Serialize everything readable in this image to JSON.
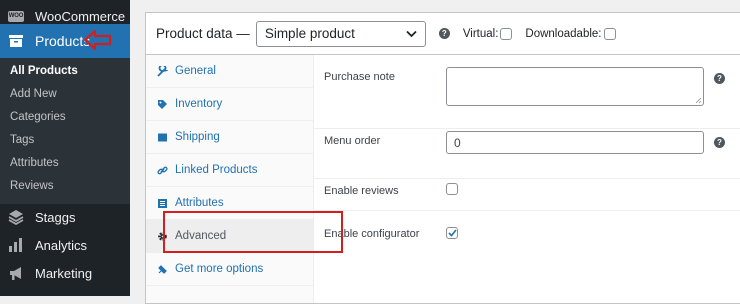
{
  "sidebar": {
    "woocommerce": {
      "label": "WooCommerce",
      "badge": "WOO"
    },
    "products": {
      "label": "Products"
    },
    "submenu": [
      {
        "label": "All Products",
        "active": true
      },
      {
        "label": "Add New"
      },
      {
        "label": "Categories"
      },
      {
        "label": "Tags"
      },
      {
        "label": "Attributes"
      },
      {
        "label": "Reviews"
      }
    ],
    "staggs": {
      "label": "Staggs"
    },
    "analytics": {
      "label": "Analytics"
    },
    "marketing": {
      "label": "Marketing"
    }
  },
  "product_data": {
    "label": "Product data —",
    "type_select": "Simple product",
    "virtual_label": "Virtual:",
    "downloadable_label": "Downloadable:",
    "virtual_checked": false,
    "downloadable_checked": false
  },
  "tabs": [
    {
      "label": "General",
      "icon": "wrench-icon"
    },
    {
      "label": "Inventory",
      "icon": "tag-icon"
    },
    {
      "label": "Shipping",
      "icon": "truck-icon"
    },
    {
      "label": "Linked Products",
      "icon": "link-icon"
    },
    {
      "label": "Attributes",
      "icon": "list-icon"
    },
    {
      "label": "Advanced",
      "icon": "gear-icon",
      "active": true
    },
    {
      "label": "Get more options",
      "icon": "plugin-icon"
    }
  ],
  "fields": {
    "purchase_note": {
      "label": "Purchase note",
      "value": ""
    },
    "menu_order": {
      "label": "Menu order",
      "value": "0"
    },
    "enable_reviews": {
      "label": "Enable reviews",
      "checked": false
    },
    "enable_configurator": {
      "label": "Enable configurator",
      "checked": true
    }
  },
  "colors": {
    "accent": "#2271b1",
    "highlight": "#d41e1e",
    "sidebar": "#1d2327"
  }
}
